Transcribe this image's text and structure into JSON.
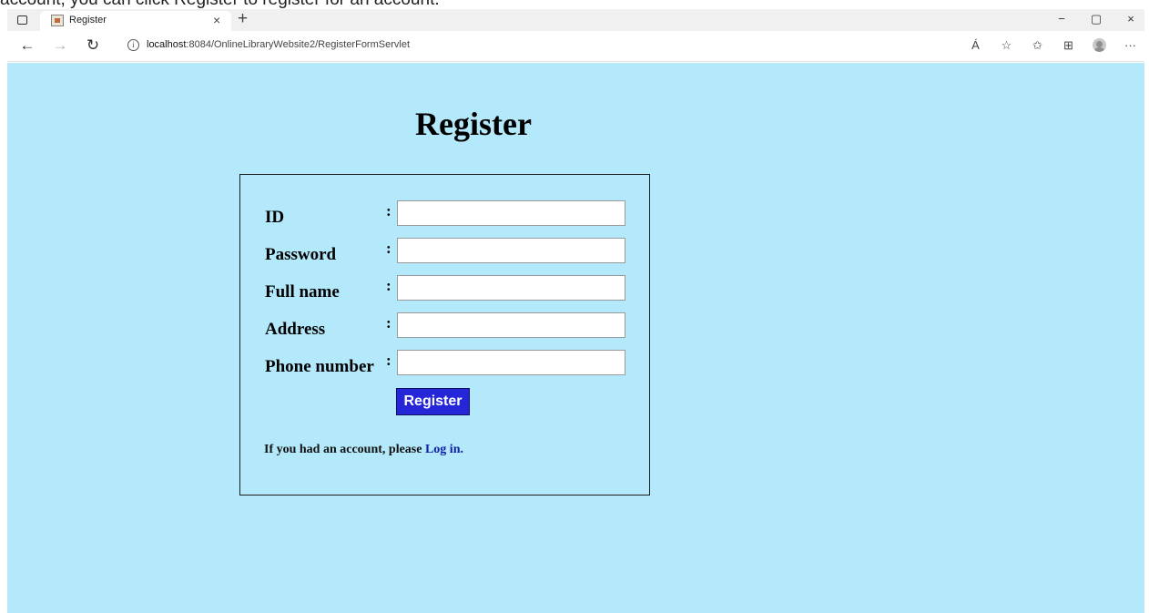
{
  "page_header_cropped_text": "account, you can click Register to register for an account.",
  "browser": {
    "tab_title": "Register",
    "tab_close": "×",
    "new_tab": "+",
    "url_host": "localhost",
    "url_rest": ":8084/OnlineLibraryWebsite2/RegisterFormServlet",
    "window_controls": [
      "−",
      "▢",
      "×"
    ],
    "nav": {
      "back": "←",
      "forward": "→",
      "reload": "↻"
    },
    "toolbar_icons": [
      "read-aloud-icon",
      "favorite-add-icon",
      "favorites-icon",
      "collections-icon",
      "profile-icon",
      "more-icon"
    ],
    "toolbar_glyphs": {
      "read_aloud": "Á",
      "favorite_add": "☆",
      "favorites": "✩",
      "collections": "⊞",
      "more": "···"
    }
  },
  "page": {
    "background": "#b3e9fb",
    "title": "Register",
    "fields": [
      {
        "label": "ID",
        "colon": ":",
        "value": ""
      },
      {
        "label": "Password",
        "colon": ":",
        "value": ""
      },
      {
        "label": "Full name",
        "colon": ":",
        "value": ""
      },
      {
        "label": "Address",
        "colon": ":",
        "value": ""
      },
      {
        "label": "Phone number",
        "colon": ":",
        "value": ""
      }
    ],
    "submit_label": "Register",
    "submit_color": "#2626d9",
    "footer_text": "If you had an account, please ",
    "login_link": "Log in."
  }
}
